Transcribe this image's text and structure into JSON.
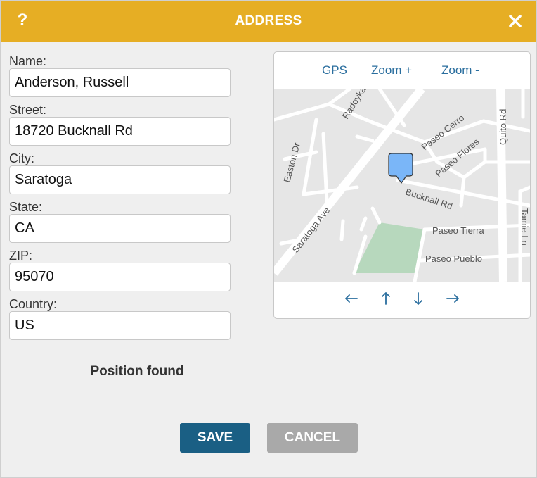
{
  "dialog": {
    "title": "ADDRESS",
    "help_label": "?",
    "accent_color": "#e6ae24"
  },
  "form": {
    "name": {
      "label": "Name:",
      "value": "Anderson, Russell"
    },
    "street": {
      "label": "Street:",
      "value": "18720 Bucknall Rd"
    },
    "city": {
      "label": "City:",
      "value": "Saratoga"
    },
    "state": {
      "label": "State:",
      "value": "CA"
    },
    "zip": {
      "label": "ZIP:",
      "value": "95070"
    },
    "country": {
      "label": "Country:",
      "value": "US"
    }
  },
  "status": "Position found",
  "map": {
    "toolbar": {
      "gps": "GPS",
      "zoom_in": "Zoom +",
      "zoom_out": "Zoom -"
    },
    "streets": {
      "saratoga_ave": "Saratoga Ave",
      "radoyka": "Radoyka",
      "easton_dr": "Easton Dr",
      "paseo_cerro": "Paseo Cerro",
      "paseo_flores": "Paseo Flores",
      "quito_rd": "Quito Rd",
      "bucknall_rd": "Bucknall Rd",
      "paseo_tierra": "Paseo Tierra",
      "paseo_pueblo": "Paseo Pueblo",
      "tamie_ln": "Tamie Ln"
    },
    "nav": [
      "←",
      "↑",
      "↓",
      "→"
    ]
  },
  "buttons": {
    "save": "SAVE",
    "cancel": "CANCEL"
  }
}
